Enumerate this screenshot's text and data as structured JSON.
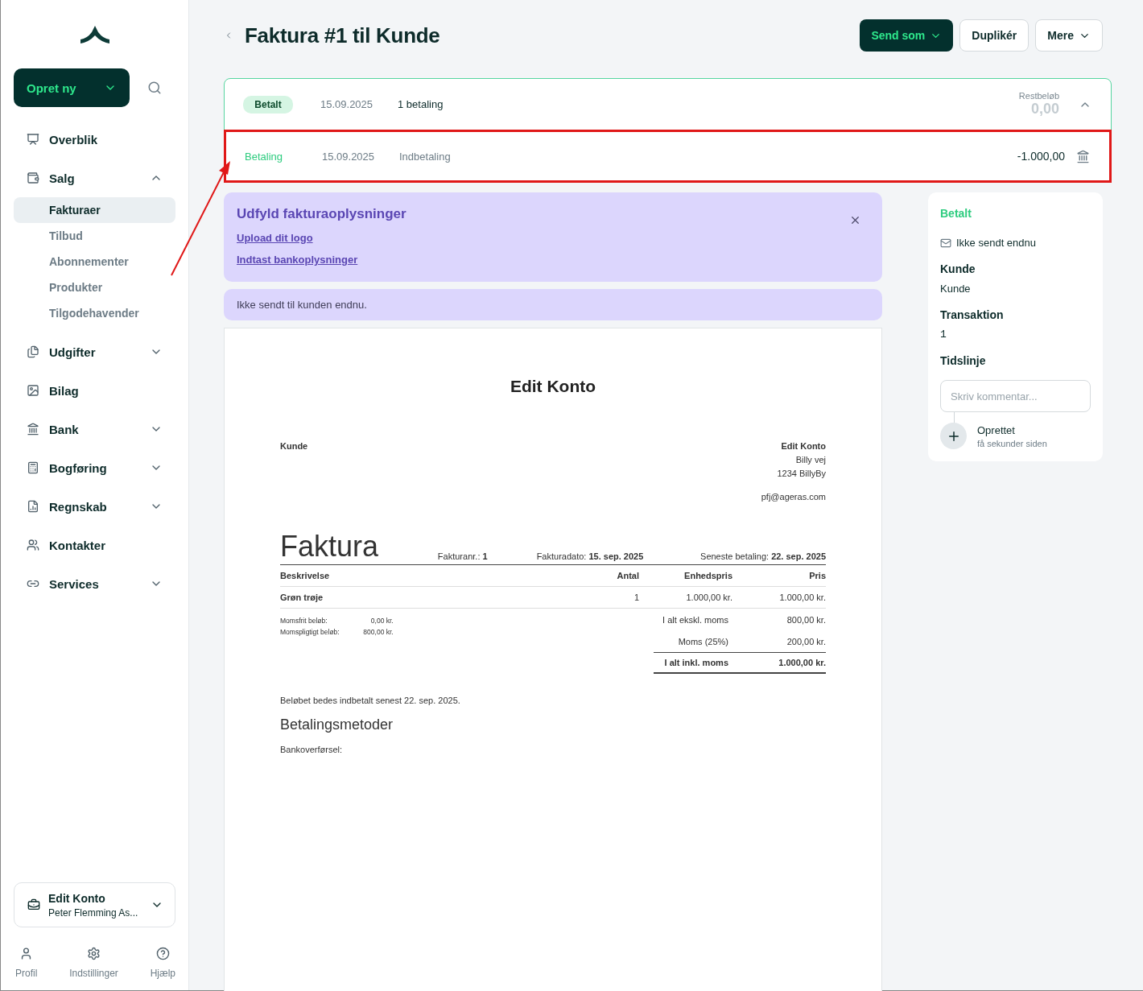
{
  "sidebar": {
    "create_button": "Opret ny",
    "nav": [
      {
        "label": "Overblik"
      },
      {
        "label": "Salg",
        "expanded": true,
        "children": [
          {
            "label": "Fakturaer",
            "selected": true
          },
          {
            "label": "Tilbud",
            "selected": false
          },
          {
            "label": "Abonnementer",
            "selected": false
          },
          {
            "label": "Produkter",
            "selected": false
          },
          {
            "label": "Tilgodehavender",
            "selected": false
          }
        ]
      },
      {
        "label": "Udgifter",
        "expanded": false
      },
      {
        "label": "Bilag"
      },
      {
        "label": "Bank",
        "expanded": false
      },
      {
        "label": "Bogføring",
        "expanded": false
      },
      {
        "label": "Regnskab",
        "expanded": false
      },
      {
        "label": "Kontakter"
      },
      {
        "label": "Services",
        "expanded": false
      }
    ],
    "account": {
      "name": "Edit Konto",
      "subtitle": "Peter Flemming As..."
    },
    "footer": [
      {
        "label": "Profil"
      },
      {
        "label": "Indstillinger"
      },
      {
        "label": "Hjælp"
      }
    ]
  },
  "header": {
    "title": "Faktura #1 til Kunde",
    "actions": [
      {
        "label": "Send som",
        "kind": "primary",
        "dropdown": true
      },
      {
        "label": "Duplikér",
        "kind": "secondary",
        "dropdown": false
      },
      {
        "label": "Mere",
        "kind": "secondary",
        "dropdown": true
      }
    ]
  },
  "status_card": {
    "badge": "Betalt",
    "date": "15.09.2025",
    "summary": "1 betaling",
    "remaining_label": "Restbeløb",
    "remaining": "0,00",
    "expanded": true,
    "payments": [
      {
        "type": "Betaling",
        "date": "15.09.2025",
        "description": "Indbetaling",
        "amount": "-1.000,00",
        "highlighted": true
      }
    ]
  },
  "notice": {
    "title": "Udfyld fakturaoplysninger",
    "links": [
      "Upload dit logo",
      "Indtast bankoplysninger"
    ]
  },
  "info_banner": "Ikke sendt til kunden endnu.",
  "invoice": {
    "company_title": "Edit Konto",
    "customer": "Kunde",
    "sender": [
      "Edit Konto",
      "Billy vej",
      "1234 BillyBy"
    ],
    "email": "pfj@ageras.com",
    "heading": "Faktura",
    "meta": [
      {
        "label": "Fakturanr.:",
        "value": "1"
      },
      {
        "label": "Fakturadato:",
        "value": "15. sep. 2025"
      },
      {
        "label": "Seneste betaling:",
        "value": "22. sep. 2025"
      }
    ],
    "columns": [
      "Beskrivelse",
      "Antal",
      "Enhedspris",
      "Pris"
    ],
    "rows": [
      [
        "Grøn trøje",
        "1",
        "1.000,00 kr.",
        "1.000,00 kr."
      ]
    ],
    "vat_summary": [
      {
        "label": "Momsfrit beløb:",
        "value": "0,00 kr."
      },
      {
        "label": "Momspligtigt beløb:",
        "value": "800,00 kr."
      }
    ],
    "totals": [
      {
        "label": "I alt ekskl. moms",
        "value": "800,00 kr.",
        "kind": "sub"
      },
      {
        "label": "Moms (25%)",
        "value": "200,00 kr.",
        "kind": "sub"
      },
      {
        "label": "I alt inkl. moms",
        "value": "1.000,00 kr.",
        "kind": "grand"
      }
    ],
    "due_text": "Beløbet bedes indbetalt senest 22. sep. 2025.",
    "methods_heading": "Betalingsmetoder",
    "methods": [
      "Bankoverførsel:"
    ]
  },
  "side_panel": {
    "status": "Betalt",
    "sent_status": "Ikke sendt endnu",
    "fields": [
      {
        "label": "Kunde",
        "value": "Kunde",
        "kind": "text"
      },
      {
        "label": "Transaktion",
        "value": "1",
        "kind": "mono"
      }
    ],
    "timeline_label": "Tidslinje",
    "comment_placeholder": "Skriv kommentar...",
    "events": [
      {
        "title": "Oprettet",
        "time": "få sekunder siden"
      }
    ]
  }
}
